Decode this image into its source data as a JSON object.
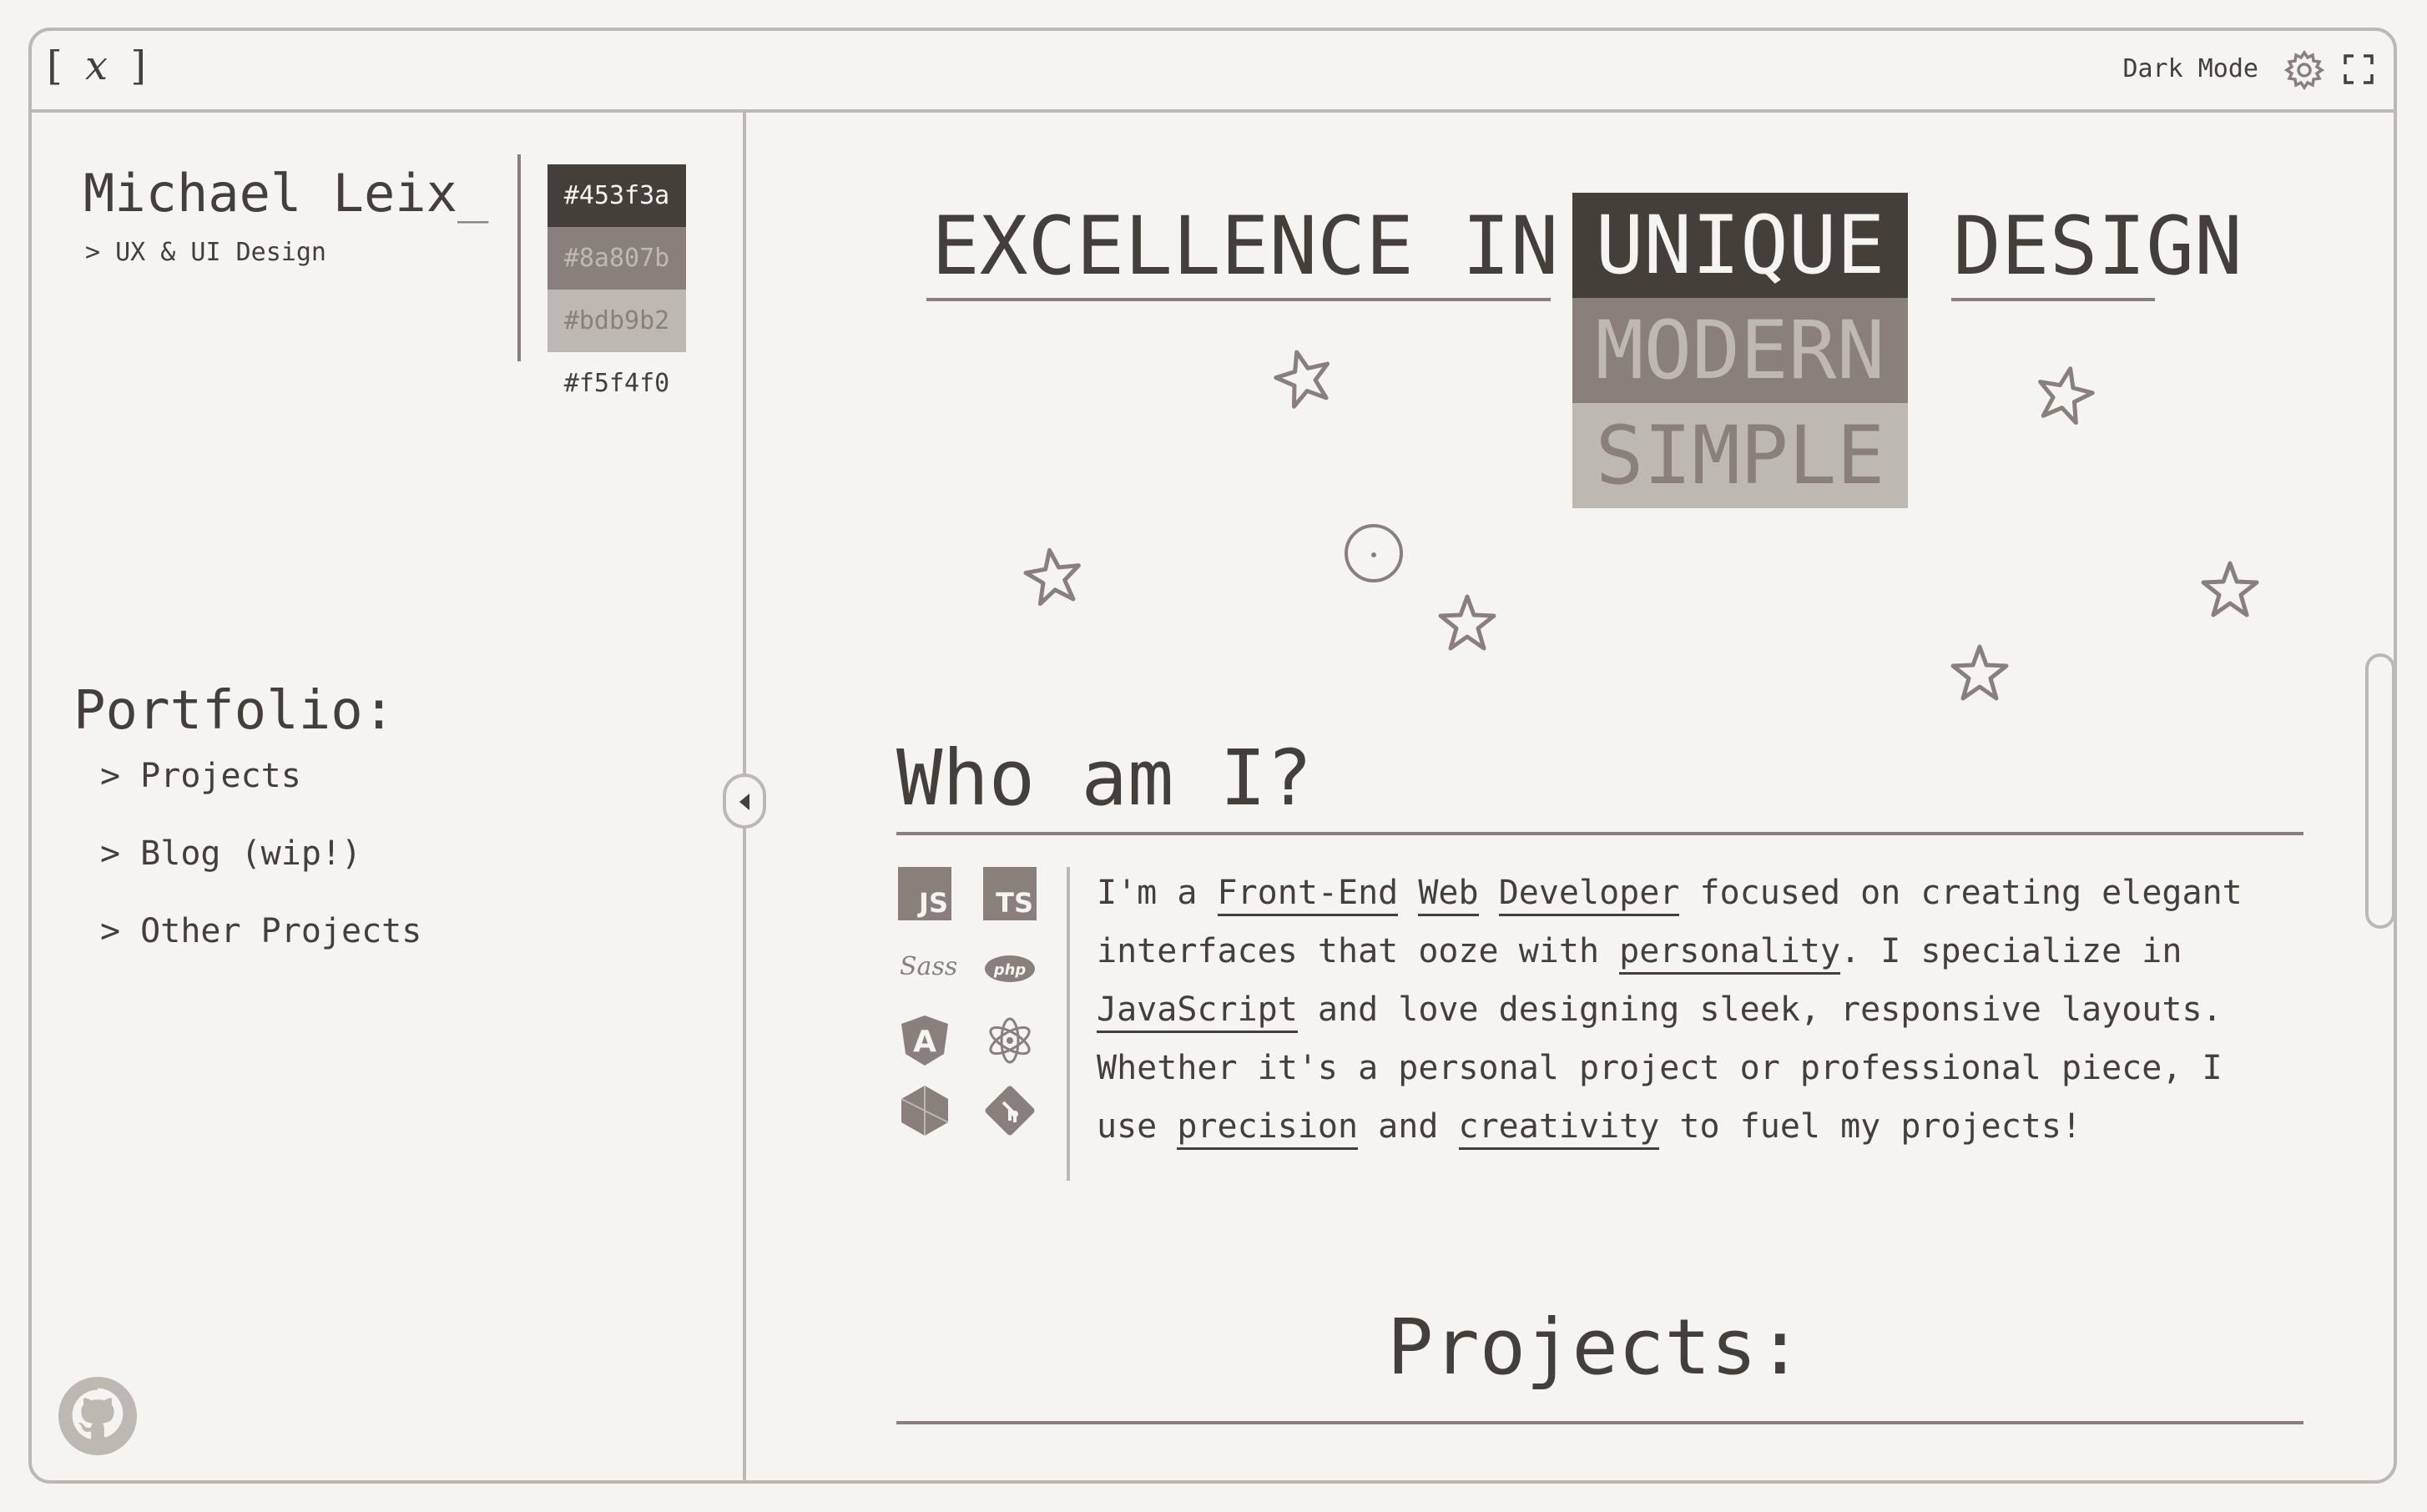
{
  "header": {
    "logo_left": "[",
    "logo_mid": "x",
    "logo_right": "]",
    "dark_mode_label": "Dark Mode",
    "icons": [
      "gear-icon",
      "fullscreen-icon"
    ]
  },
  "profile": {
    "name": "Michael Leix",
    "cursor": "_",
    "role": "> UX & UI Design"
  },
  "palette": [
    {
      "label": "#453f3a",
      "bg": "#453f3a",
      "fg": "#f5f4f0"
    },
    {
      "label": "#8a807b",
      "bg": "#8a807b",
      "fg": "#bdb9b2"
    },
    {
      "label": "#bdb9b2",
      "bg": "#bdb9b2",
      "fg": "#8a807b"
    },
    {
      "label": "#f5f4f0",
      "bg": "#f5f4f0",
      "fg": "#453f3a"
    }
  ],
  "portfolio": {
    "title": "Portfolio:",
    "items": [
      "> Projects",
      "> Blog (wip!)",
      "> Other Projects"
    ]
  },
  "hero": {
    "word1": "EXCELLENCE IN",
    "rotating": [
      "UNIQUE",
      "MODERN",
      "SIMPLE"
    ],
    "word2": "DESIGN"
  },
  "about": {
    "title": "Who am I?",
    "bio_parts": [
      "I'm a ",
      "Front-End",
      " ",
      "Web",
      " ",
      "Developer",
      " focused on creating elegant interfaces that ooze with ",
      "personality",
      ". I specialize in ",
      "JavaScript",
      " and love designing sleek, responsive layouts. Whether it's a personal project or professional piece, I use ",
      "precision",
      " and ",
      "creativity",
      " to fuel my projects!"
    ],
    "tech_icons": [
      "JS",
      "TS",
      "Sass",
      "php",
      "A"
    ]
  },
  "projects": {
    "title": "Projects:"
  },
  "colors": {
    "dark": "#453f3a",
    "mid": "#8a807b",
    "light": "#bdb9b2",
    "bg": "#f5f4f0"
  }
}
